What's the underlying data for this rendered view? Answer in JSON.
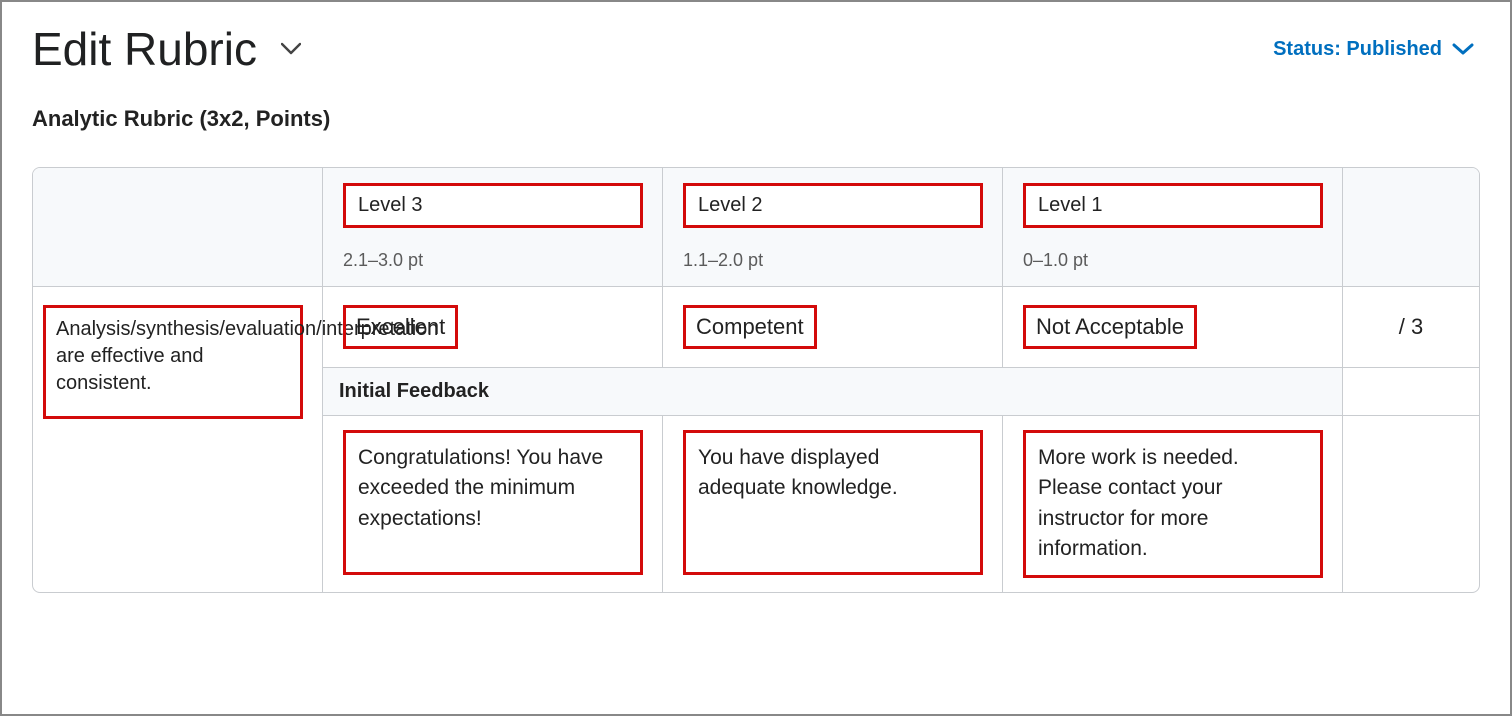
{
  "page": {
    "title": "Edit Rubric",
    "status_label": "Status: Published",
    "subheading": "Analytic Rubric (3x2, Points)"
  },
  "rubric": {
    "levels": [
      {
        "name": "Level 3",
        "range": "2.1–3.0 pt"
      },
      {
        "name": "Level 2",
        "range": "1.1–2.0 pt"
      },
      {
        "name": "Level 1",
        "range": "0–1.0 pt"
      }
    ],
    "criterion": "Analysis/synthesis/evaluation/interpretation are effective and consistent.",
    "descriptors": [
      "Excellent",
      "Competent",
      "Not Acceptable"
    ],
    "points_display": "/ 3",
    "feedback_heading": "Initial Feedback",
    "feedback": [
      "Congratulations! You have exceeded the minimum expectations!",
      "You have displayed adequate knowledge.",
      "More work is needed. Please contact your instructor for more information."
    ]
  }
}
